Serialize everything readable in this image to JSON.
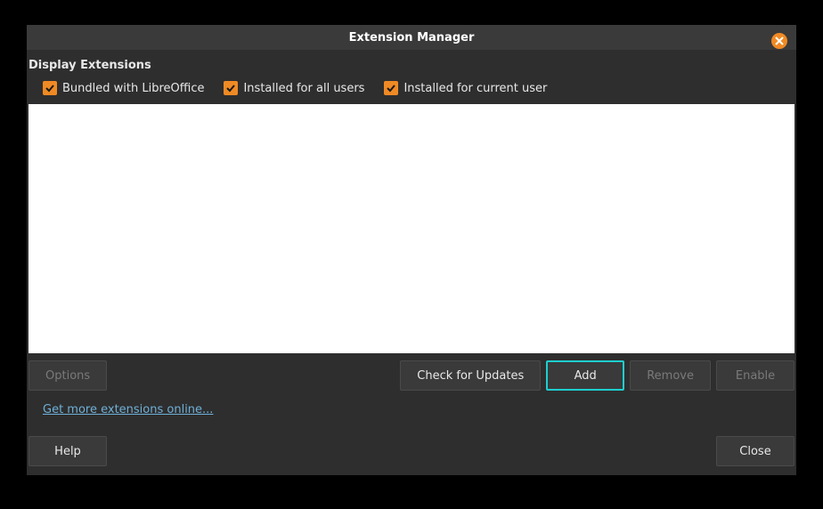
{
  "title": "Extension Manager",
  "section_label": "Display Extensions",
  "filters": {
    "bundled": {
      "label": "Bundled with LibreOffice",
      "checked": true
    },
    "all_users": {
      "label": "Installed for all users",
      "checked": true
    },
    "current_user": {
      "label": "Installed for current user",
      "checked": true
    }
  },
  "buttons": {
    "options": "Options",
    "check_updates": "Check for Updates",
    "add": "Add",
    "remove": "Remove",
    "enable": "Enable",
    "help": "Help",
    "close": "Close"
  },
  "link": "Get more extensions online...",
  "colors": {
    "accent": "#f08a24",
    "focus": "#1fcfcf",
    "link": "#6fb0d8",
    "bg": "#2e2e2e"
  }
}
